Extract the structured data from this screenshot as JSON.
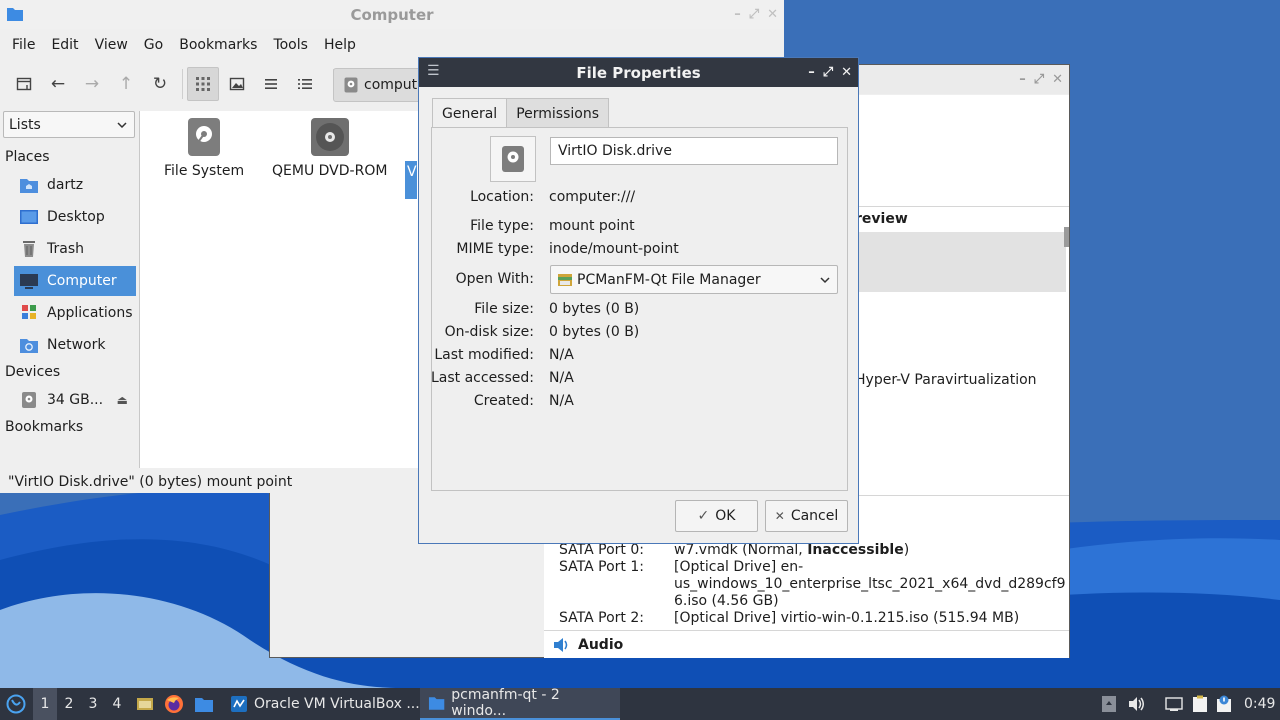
{
  "file_manager": {
    "title": "Computer",
    "menu": [
      "File",
      "Edit",
      "View",
      "Go",
      "Bookmarks",
      "Tools",
      "Help"
    ],
    "path_text": "comput",
    "view_mode": "Lists",
    "sections": {
      "places": "Places",
      "devices": "Devices",
      "bookmarks": "Bookmarks"
    },
    "places": [
      "dartz",
      "Desktop",
      "Trash",
      "Computer",
      "Applications",
      "Network"
    ],
    "selected_place": "Computer",
    "devices": [
      "34 GB..."
    ],
    "files": [
      "File System",
      "QEMU DVD-ROM",
      "V"
    ],
    "status": "\"VirtIO Disk.drive\" (0 bytes) mount point"
  },
  "virtualbox": {
    "section_preview": "review",
    "paravirt": "Hyper-V Paravirtualization",
    "storage": [
      {
        "port": "SATA Port 0:",
        "pre": "w7.vmdk (Normal, ",
        "bold": "Inaccessible",
        "post": ")"
      },
      {
        "port": "SATA Port 1:",
        "lines": [
          "[Optical Drive] en-",
          "us_windows_10_enterprise_ltsc_2021_x64_dvd_d289cf9",
          "6.iso (4.56 GB)"
        ]
      },
      {
        "port": "SATA Port 2:",
        "lines": [
          "[Optical Drive] virtio-win-0.1.215.iso (515.94 MB)"
        ]
      }
    ],
    "audio_heading": "Audio"
  },
  "dialog": {
    "title": "File Properties",
    "tabs": [
      "General",
      "Permissions"
    ],
    "name_value": "VirtIO Disk.drive",
    "labels": {
      "location": "Location:",
      "file_type": "File type:",
      "mime_type": "MIME type:",
      "open_with": "Open With:",
      "file_size": "File size:",
      "on_disk_size": "On-disk size:",
      "last_modified": "Last modified:",
      "last_accessed": "Last accessed:",
      "created": "Created:"
    },
    "values": {
      "location": "computer:///",
      "file_type": "mount point",
      "mime_type": "inode/mount-point",
      "open_with": "PCManFM-Qt File Manager",
      "file_size": "0 bytes (0 B)",
      "on_disk_size": "0 bytes (0 B)",
      "last_modified": "N/A",
      "last_accessed": "N/A",
      "created": "N/A"
    },
    "ok": "OK",
    "cancel": "Cancel"
  },
  "taskbar": {
    "desktops": [
      "1",
      "2",
      "3",
      "4"
    ],
    "current_desktop": "1",
    "tasks": [
      "Oracle VM VirtualBox ...",
      "pcmanfm-qt - 2 windo..."
    ],
    "clock": "0:49"
  },
  "colors": {
    "selection": "#4a90d9",
    "taskbar": "#2e3440",
    "dialog_titlebar": "#323741",
    "wallpaper": "#1f5fbf"
  }
}
